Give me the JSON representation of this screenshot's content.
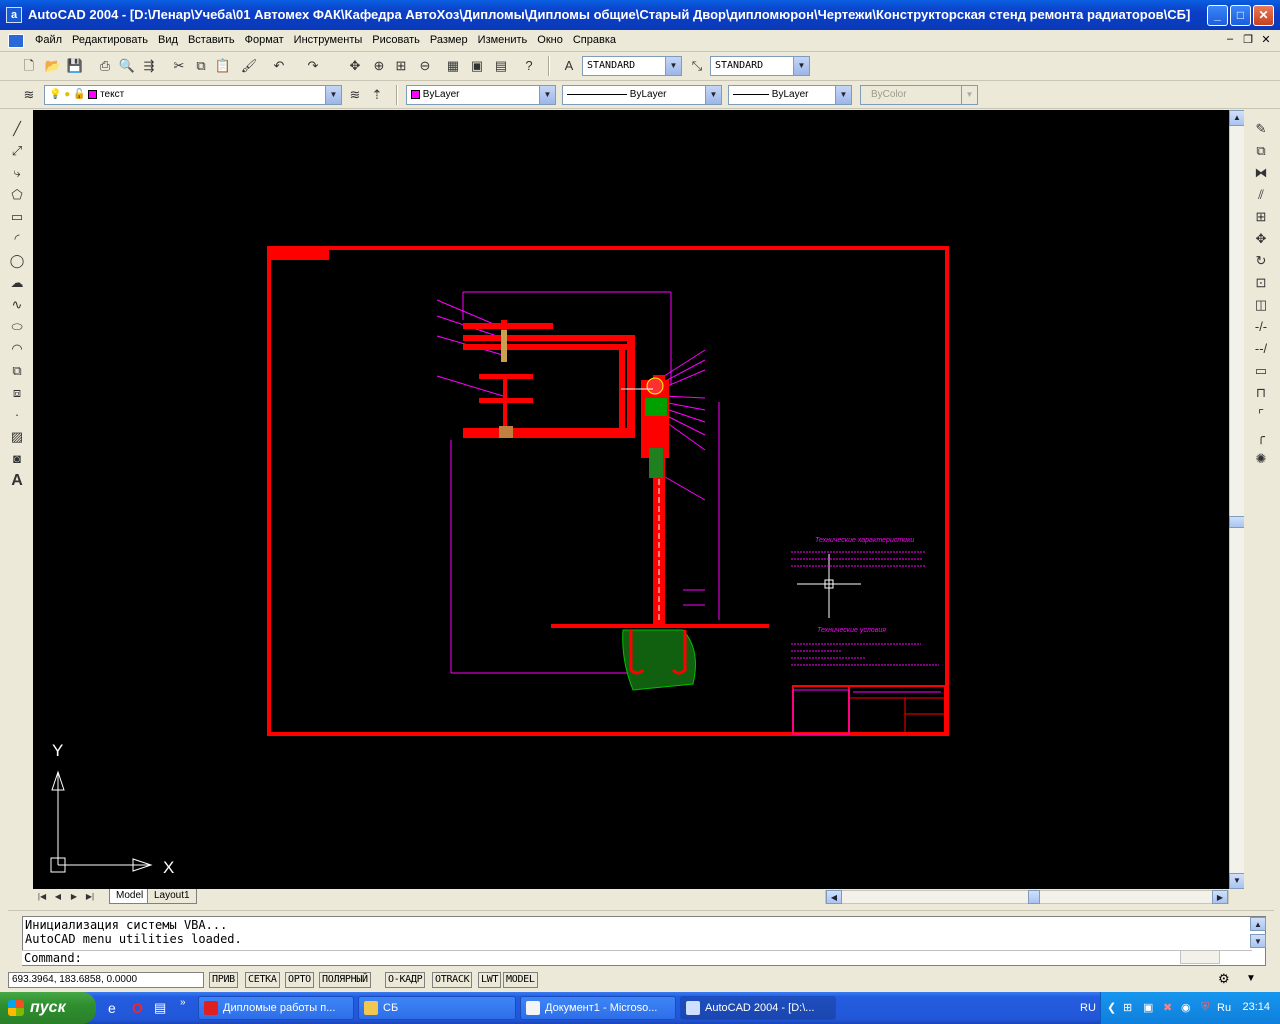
{
  "window": {
    "title": "AutoCAD 2004 - [D:\\Ленар\\Учеба\\01 Автомех ФАК\\Кафедра АвтоХоз\\Дипломы\\Дипломы общие\\Старый Двор\\дипломюрон\\Чертежи\\Конструкторская стенд ремонта радиаторов\\СБ]",
    "app_icon": "a"
  },
  "menu": [
    "Файл",
    "Редактировать",
    "Вид",
    "Вставить",
    "Формат",
    "Инструменты",
    "Рисовать",
    "Размер",
    "Изменить",
    "Окно",
    "Справка"
  ],
  "toolbar_std": {
    "text_style": "STANDARD",
    "dim_style": "STANDARD"
  },
  "toolbar_props": {
    "layer": "текст",
    "color": "ByLayer",
    "linetype": "ByLayer",
    "lineweight": "ByLayer",
    "plotstyle": "ByColor"
  },
  "drawing": {
    "title_text": "Технические характеристики",
    "tech_req": "Технические условия",
    "ucs_x": "X",
    "ucs_y": "Y"
  },
  "tabs": [
    "Model",
    "Layout1"
  ],
  "command": {
    "history": [
      "Инициализация системы VBA...",
      "AutoCAD menu utilities loaded."
    ],
    "prompt": "Command:"
  },
  "status": {
    "coords": "693.3964, 183.6858, 0.0000",
    "buttons": [
      "ПРИВ",
      "СЕТКА",
      "ОРТО",
      "ПОЛЯРНЫЙ",
      "О-КАДР",
      "OTRACK",
      "LWT",
      "MODEL"
    ]
  },
  "taskbar": {
    "start": "пуск",
    "tasks": [
      "Дипломые работы п...",
      "СБ",
      "Документ1 - Microso...",
      "AutoCAD 2004 - [D:\\..."
    ],
    "lang": "RU",
    "lang2": "Ru",
    "clock": "23:14"
  },
  "colors": {
    "frame": "#ff0000",
    "annotation": "#ff00ff",
    "hatch": "#00c000",
    "canvas": "#000000"
  }
}
